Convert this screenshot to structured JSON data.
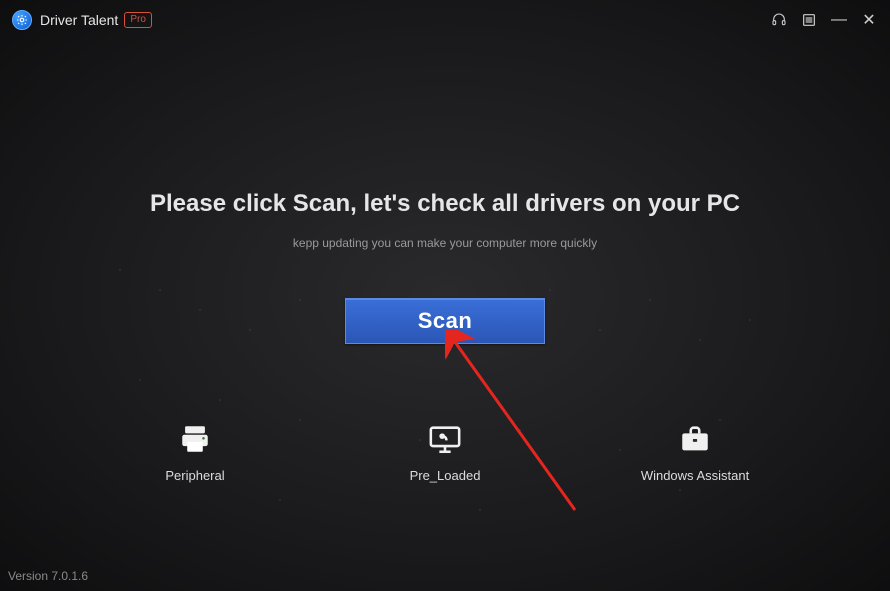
{
  "app": {
    "title": "Driver Talent",
    "badge": "Pro"
  },
  "main": {
    "headline": "Please click Scan, let's check all drivers on your PC",
    "subline": "kepp updating you can make your computer more quickly",
    "scan_label": "Scan"
  },
  "categories": [
    {
      "label": "Peripheral",
      "icon": "printer-icon"
    },
    {
      "label": "Pre_Loaded",
      "icon": "monitor-icon"
    },
    {
      "label": "Windows Assistant",
      "icon": "briefcase-icon"
    }
  ],
  "footer": {
    "version": "Version 7.0.1.6"
  }
}
